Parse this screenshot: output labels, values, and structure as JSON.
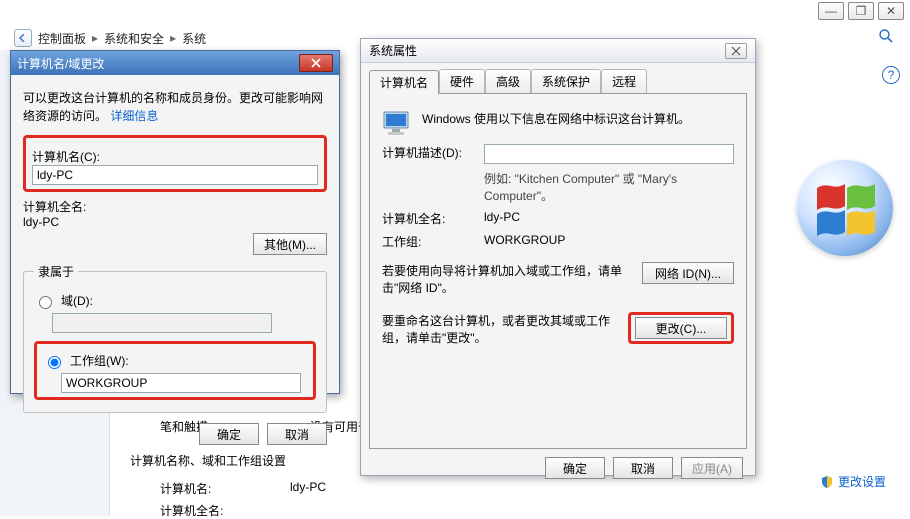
{
  "chrome": {
    "min": "—",
    "max": "❐",
    "close": "✕"
  },
  "breadcrumb": {
    "items": [
      "控制面板",
      "系统和安全",
      "系统"
    ]
  },
  "dlg1": {
    "title": "计算机名/域更改",
    "desc_a": "可以更改这台计算机的名称和成员身份。更改可能影响网络资源的访问。",
    "desc_link": "详细信息",
    "name_label": "计算机名(C):",
    "name_value": "ldy-PC",
    "fullname_label": "计算机全名:",
    "fullname_value": "ldy-PC",
    "other_btn": "其他(M)...",
    "fieldset_legend": "隶属于",
    "domain_label": "域(D):",
    "workgroup_label": "工作组(W):",
    "workgroup_value": "WORKGROUP",
    "ok": "确定",
    "cancel": "取消"
  },
  "dlg2": {
    "title": "系统属性",
    "tabs": [
      "计算机名",
      "硬件",
      "高级",
      "系统保护",
      "远程"
    ],
    "intro": "Windows 使用以下信息在网络中标识这台计算机。",
    "desc_label": "计算机描述(D):",
    "desc_hint": "例如: \"Kitchen Computer\" 或 \"Mary's Computer\"。",
    "fullname_label": "计算机全名:",
    "fullname_value": "ldy-PC",
    "workgroup_label": "工作组:",
    "workgroup_value": "WORKGROUP",
    "netid_text": "若要使用向导将计算机加入域或工作组，请单击\"网络 ID\"。",
    "netid_btn": "网络 ID(N)...",
    "change_text": "要重命名这台计算机，或者更改其域或工作组，请单击\"更改\"。",
    "change_btn": "更改(C)...",
    "ok": "确定",
    "cancel": "取消",
    "apply": "应用(A)"
  },
  "bg": {
    "pen_label": "笔和触摸:",
    "pen_value": "没有可用于",
    "section": "计算机名称、域和工作组设置",
    "cpu_name_label": "计算机名:",
    "cpu_name_value": "ldy-PC",
    "cpu_full_label": "计算机全名:",
    "help_icon": "?",
    "change_link": "更改设置"
  }
}
